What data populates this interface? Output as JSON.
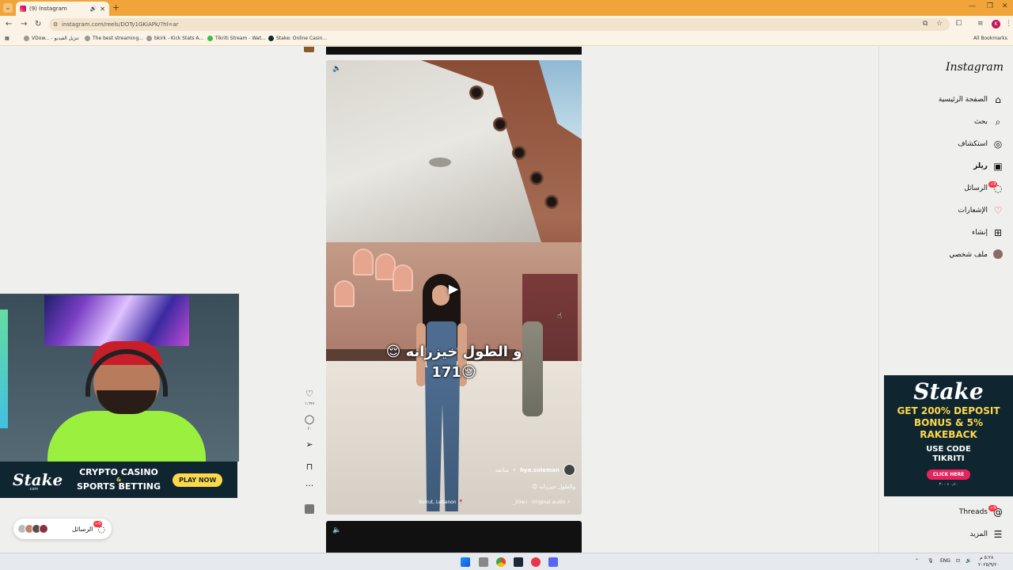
{
  "browser": {
    "tab_title": "(9) Instagram",
    "url": "instagram.com/reels/DOTy1GKiAPk/?hl=ar",
    "bookmarks": [
      {
        "label": "VDow... - تنزيل الفيديو"
      },
      {
        "label": "The best streaming..."
      },
      {
        "label": "bkirk - Kick Stats A..."
      },
      {
        "label": "Tikriti Stream - Wat..."
      },
      {
        "label": "Stake: Online Casin..."
      }
    ],
    "all_bookmarks": "All Bookmarks"
  },
  "reel": {
    "caption_line1": "و الطول خيزرانه 😌",
    "caption_line2": "171😌",
    "username": "hya.soleman",
    "follow": "متابعة",
    "description": "والطول خيزرانه 😌",
    "location": "Beirut, Lebanon 📍",
    "audio": "_20w.i · Original audio ↗",
    "like_count": "١،٦٩٩",
    "comment_count": "٢٠"
  },
  "sidebar": {
    "logo": "Instagram",
    "items": [
      {
        "label": "الصفحة الرئيسية",
        "icon": "home-icon"
      },
      {
        "label": "بحث",
        "icon": "search-icon"
      },
      {
        "label": "استكشاف",
        "icon": "explore-icon"
      },
      {
        "label": "ريلز",
        "icon": "reels-icon"
      },
      {
        "label": "الرسائل",
        "icon": "messenger-icon",
        "badge": "+9"
      },
      {
        "label": "الإشعارات",
        "icon": "heart-icon"
      },
      {
        "label": "إنشاء",
        "icon": "create-icon"
      },
      {
        "label": "ملف شخصي",
        "icon": "profile-avatar"
      }
    ],
    "threads": "Threads",
    "threads_badge": "+9",
    "more": "المزيد"
  },
  "ad_right": {
    "brand": "Stake",
    "promo_line1": "GET 200% DEPOSIT",
    "promo_line2": "BONUS & 5%",
    "promo_line3": "RAKEBACK",
    "code_line1": "USE CODE",
    "code_line2": "TIKRITI",
    "cta": "CLICK HERE",
    "small": "٠٫١٠ ٪ ٢٠٠"
  },
  "ad_banner": {
    "brand": "Stake",
    "brand_sub": ".com",
    "line1": "CRYPTO CASINO",
    "amp": "&",
    "line2": "SPORTS BETTING",
    "cta": "PLAY NOW"
  },
  "messages_pill": {
    "label": "الرسائل",
    "badge": "+9"
  },
  "taskbar": {
    "lang": "ENG",
    "time": "٥:٢٨ م",
    "date": "٢٠٢٥/٩/٢٠"
  },
  "colors": {
    "tabbar": "#f0a43a",
    "stake_bg": "#0f2530",
    "stake_yellow": "#ffd84a",
    "badge_red": "#ff3040"
  }
}
